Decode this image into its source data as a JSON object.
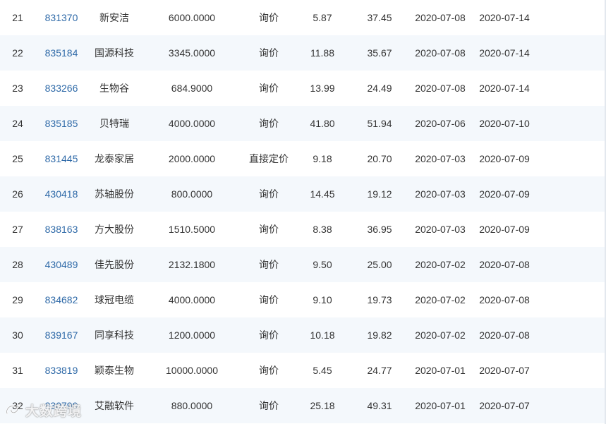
{
  "colors": {
    "code_link": "#2f6aa8",
    "text": "#333333",
    "row_alt_bg": "#f4f8fc"
  },
  "rows": [
    {
      "idx": "21",
      "code": "831370",
      "name": "新安洁",
      "volume": "6000.0000",
      "method": "询价",
      "price": "5.87",
      "pe": "37.45",
      "date1": "2020-07-08",
      "date2": "2020-07-14"
    },
    {
      "idx": "22",
      "code": "835184",
      "name": "国源科技",
      "volume": "3345.0000",
      "method": "询价",
      "price": "11.88",
      "pe": "35.67",
      "date1": "2020-07-08",
      "date2": "2020-07-14"
    },
    {
      "idx": "23",
      "code": "833266",
      "name": "生物谷",
      "volume": "684.9000",
      "method": "询价",
      "price": "13.99",
      "pe": "24.49",
      "date1": "2020-07-08",
      "date2": "2020-07-14"
    },
    {
      "idx": "24",
      "code": "835185",
      "name": "贝特瑞",
      "volume": "4000.0000",
      "method": "询价",
      "price": "41.80",
      "pe": "51.94",
      "date1": "2020-07-06",
      "date2": "2020-07-10"
    },
    {
      "idx": "25",
      "code": "831445",
      "name": "龙泰家居",
      "volume": "2000.0000",
      "method": "直接定价",
      "price": "9.18",
      "pe": "20.70",
      "date1": "2020-07-03",
      "date2": "2020-07-09"
    },
    {
      "idx": "26",
      "code": "430418",
      "name": "苏轴股份",
      "volume": "800.0000",
      "method": "询价",
      "price": "14.45",
      "pe": "19.12",
      "date1": "2020-07-03",
      "date2": "2020-07-09"
    },
    {
      "idx": "27",
      "code": "838163",
      "name": "方大股份",
      "volume": "1510.5000",
      "method": "询价",
      "price": "8.38",
      "pe": "36.95",
      "date1": "2020-07-03",
      "date2": "2020-07-09"
    },
    {
      "idx": "28",
      "code": "430489",
      "name": "佳先股份",
      "volume": "2132.1800",
      "method": "询价",
      "price": "9.50",
      "pe": "25.00",
      "date1": "2020-07-02",
      "date2": "2020-07-08"
    },
    {
      "idx": "29",
      "code": "834682",
      "name": "球冠电缆",
      "volume": "4000.0000",
      "method": "询价",
      "price": "9.10",
      "pe": "19.73",
      "date1": "2020-07-02",
      "date2": "2020-07-08"
    },
    {
      "idx": "30",
      "code": "839167",
      "name": "同享科技",
      "volume": "1200.0000",
      "method": "询价",
      "price": "10.18",
      "pe": "19.82",
      "date1": "2020-07-02",
      "date2": "2020-07-08"
    },
    {
      "idx": "31",
      "code": "833819",
      "name": "颖泰生物",
      "volume": "10000.0000",
      "method": "询价",
      "price": "5.45",
      "pe": "24.77",
      "date1": "2020-07-01",
      "date2": "2020-07-07"
    },
    {
      "idx": "32",
      "code": "830799",
      "name": "艾融软件",
      "volume": "880.0000",
      "method": "询价",
      "price": "25.18",
      "pe": "49.31",
      "date1": "2020-07-01",
      "date2": "2020-07-07"
    }
  ],
  "watermark": {
    "text": "大数跨境",
    "icon": "brand-logo-icon"
  }
}
